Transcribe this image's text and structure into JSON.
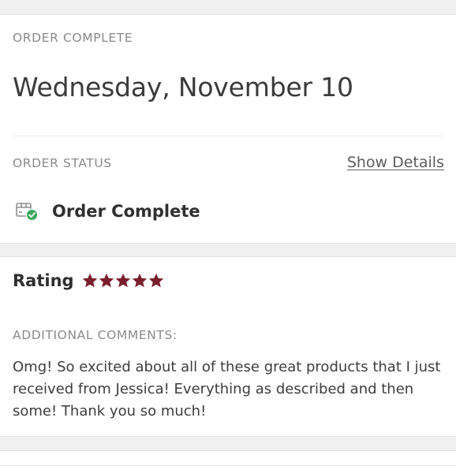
{
  "order": {
    "eyebrow": "ORDER COMPLETE",
    "date": "Wednesday, November 10",
    "status_eyebrow": "ORDER STATUS",
    "show_details": "Show Details",
    "status_label": "Order Complete",
    "status_icon": "package-check-icon"
  },
  "rating": {
    "label": "Rating",
    "stars": 5,
    "max_stars": 5,
    "star_icon": "star-icon",
    "star_color": "#7a1f2e"
  },
  "comments": {
    "eyebrow": "ADDITIONAL COMMENTS:",
    "text": "Omg! So excited about all of these great products that I just received from Jessica! Everything as described and then some! Thank you so much!"
  },
  "colors": {
    "check_green": "#3aa75a",
    "label_gray": "#8a8a8a",
    "background": "#f0f0f0"
  }
}
